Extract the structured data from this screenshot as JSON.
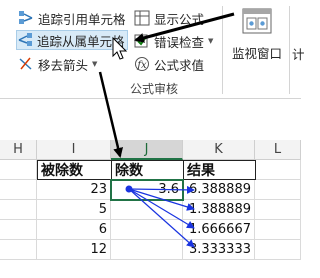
{
  "ribbon": {
    "trace_precedents": "追踪引用单元格",
    "trace_dependents": "追踪从属单元格",
    "remove_arrows": "移去箭头",
    "show_formulas": "显示公式",
    "error_checking": "错误检查",
    "evaluate_formula": "公式求值",
    "watch_window": "监视窗口",
    "cut_off": "计",
    "group_label": "公式审核"
  },
  "sheet": {
    "columns": [
      "H",
      "I",
      "J",
      "K",
      "L"
    ],
    "headers": {
      "I": "被除数",
      "J": "除数",
      "K": "结果"
    },
    "dividends": [
      "23",
      "5",
      "6",
      "12"
    ],
    "divisor": "3.6",
    "results": [
      "6.388889",
      "1.388889",
      "1.666667",
      "3.333333"
    ]
  },
  "colors": {
    "accent_green": "#217346",
    "trace_arrow": "#1a34e0",
    "annotation_arrow": "#000000"
  }
}
